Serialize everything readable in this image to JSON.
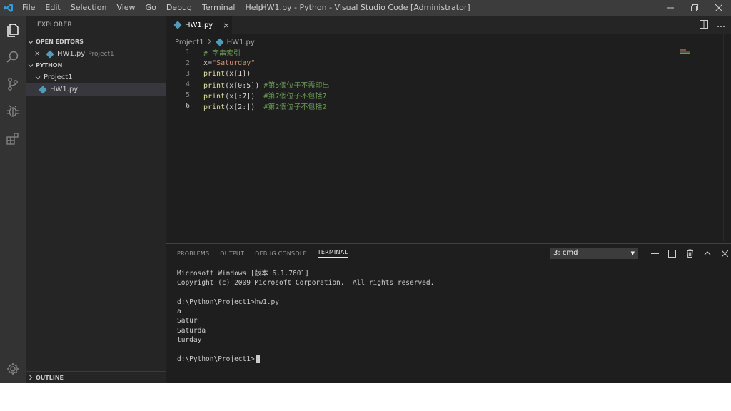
{
  "titlebar": {
    "menu": [
      "File",
      "Edit",
      "Selection",
      "View",
      "Go",
      "Debug",
      "Terminal",
      "Help"
    ],
    "window_title": "HW1.py - Python - Visual Studio Code [Administrator]",
    "brand_color": "#0078d4"
  },
  "activity_bar": {
    "icons": [
      "files-icon",
      "search-icon",
      "source-control-icon",
      "debug-icon",
      "extensions-icon",
      "settings-gear-icon"
    ]
  },
  "sidebar": {
    "title": "EXPLORER",
    "open_editors_label": "OPEN EDITORS",
    "open_editor_file": "HW1.py",
    "open_editor_folder": "Project1",
    "workspace_label": "PYTHON",
    "folder": "Project1",
    "file": "HW1.py",
    "outline_label": "OUTLINE"
  },
  "editor": {
    "tab_label": "HW1.py",
    "breadcrumb": [
      "Project1",
      "HW1.py"
    ],
    "line_numbers": [
      "1",
      "2",
      "3",
      "4",
      "5",
      "6"
    ],
    "lines": {
      "l1_comment": "# 字串索引",
      "l2_var": "x=",
      "l2_str": "\"Saturday\"",
      "l3_fn": "print",
      "l3_rest": "(x[1])",
      "l4_fn": "print",
      "l4_rest": "(x[0:5])",
      "l4_comment": " #第5個位子不需印出",
      "l5_fn": "print",
      "l5_rest": "(x[:7])",
      "l5_comment": "  #第7個位子不包括7",
      "l6_fn": "print",
      "l6_rest": "(x[2:])",
      "l6_comment": "  #第2個位子不包括2"
    }
  },
  "panel": {
    "tabs": [
      "PROBLEMS",
      "OUTPUT",
      "DEBUG CONSOLE",
      "TERMINAL"
    ],
    "active_tab": "TERMINAL",
    "terminal_selector": "3: cmd",
    "terminal_lines": [
      "Microsoft Windows [版本 6.1.7601]",
      "Copyright (c) 2009 Microsoft Corporation.  All rights reserved.",
      "",
      "d:\\Python\\Project1>hw1.py",
      "a",
      "Satur",
      "Saturda",
      "turday",
      "",
      "d:\\Python\\Project1>"
    ]
  }
}
